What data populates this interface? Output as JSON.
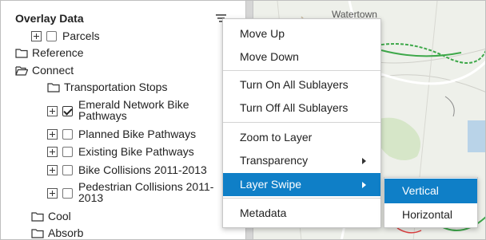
{
  "panel": {
    "title": "Overlay Data",
    "menu_icon": "menu-lines-icon",
    "items": [
      {
        "label": "Parcels",
        "expander": true,
        "checkbox": true,
        "checked": false
      },
      {
        "label": "Reference",
        "folder": "closed"
      },
      {
        "label": "Connect",
        "folder": "open"
      },
      {
        "label": "Transportation Stops",
        "folder": "closed"
      },
      {
        "label": "Emerald Network Bike Pathways",
        "expander": true,
        "checkbox": true,
        "checked": true
      },
      {
        "label": "Planned Bike Pathways",
        "expander": true,
        "checkbox": true,
        "checked": false
      },
      {
        "label": "Existing Bike Pathways",
        "expander": true,
        "checkbox": true,
        "checked": false
      },
      {
        "label": "Bike Collisions 2011-2013",
        "expander": true,
        "checkbox": true,
        "checked": false
      },
      {
        "label": "Pedestrian Collisions 2011-2013",
        "expander": true,
        "checkbox": true,
        "checked": false
      },
      {
        "label": "Cool",
        "folder": "closed"
      },
      {
        "label": "Absorb",
        "folder": "closed"
      }
    ]
  },
  "context_menu": {
    "items": [
      {
        "label": "Move Up"
      },
      {
        "label": "Move Down"
      },
      {
        "label": "Turn On All Sublayers"
      },
      {
        "label": "Turn Off All Sublayers"
      },
      {
        "label": "Zoom to Layer"
      },
      {
        "label": "Transparency",
        "submenu": true
      },
      {
        "label": "Layer Swipe",
        "submenu": true,
        "active": true
      },
      {
        "label": "Metadata"
      }
    ]
  },
  "submenu": {
    "items": [
      {
        "label": "Vertical",
        "active": true
      },
      {
        "label": "Horizontal"
      }
    ]
  },
  "map": {
    "place_label": "Watertown"
  },
  "colors": {
    "highlight": "#0f7fc7",
    "map_background": "#eef0ea",
    "map_road": "#ffffff",
    "map_green": "#3ea84a",
    "map_water": "#b9d3e8"
  }
}
